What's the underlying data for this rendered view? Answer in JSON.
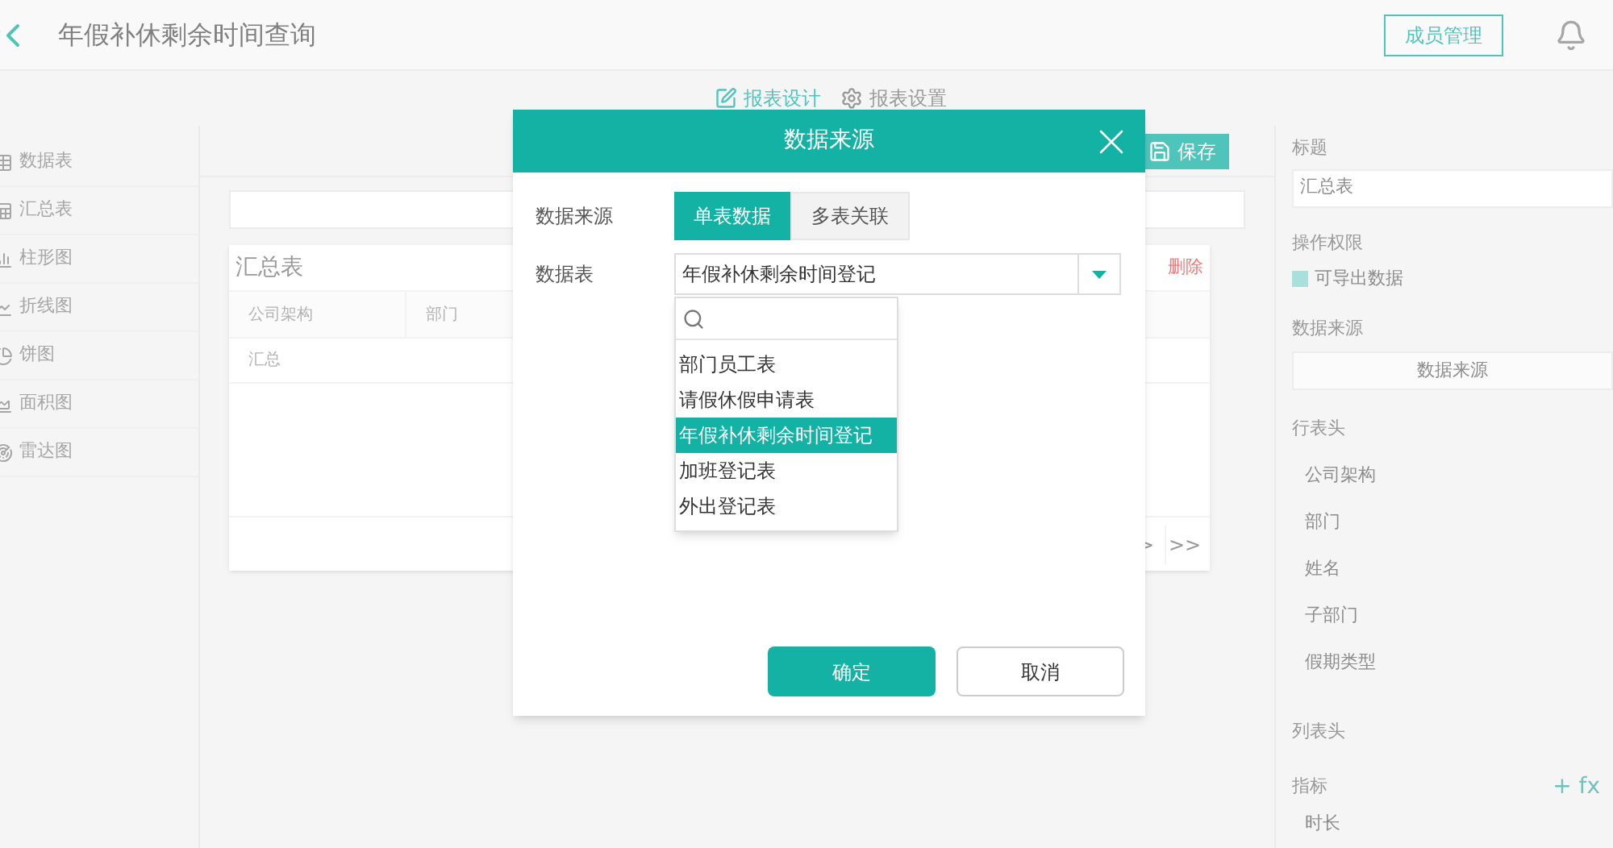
{
  "header": {
    "title": "年假补休剩余时间查询",
    "members_button": "成员管理"
  },
  "toolbar": {
    "tabs": [
      {
        "label": "报表设计",
        "selected": true
      },
      {
        "label": "报表设置",
        "selected": false
      }
    ]
  },
  "sidebar": {
    "items": [
      {
        "label": "数据表"
      },
      {
        "label": "汇总表"
      },
      {
        "label": "柱形图"
      },
      {
        "label": "折线图"
      },
      {
        "label": "饼图"
      },
      {
        "label": "面积图"
      },
      {
        "label": "雷达图"
      }
    ]
  },
  "canvas": {
    "save_button": "保存",
    "card": {
      "title": "汇总表",
      "delete": "删除",
      "columns": [
        "公司架构",
        "部门"
      ],
      "rows": [
        [
          "汇总"
        ]
      ],
      "pager": [
        ">",
        ">>"
      ]
    }
  },
  "properties": {
    "title_label": "标题",
    "title_value": "汇总表",
    "permission_label": "操作权限",
    "export": {
      "label": "可导出数据",
      "checked": true
    },
    "source_label": "数据来源",
    "source_button": "数据来源",
    "row_header_label": "行表头",
    "row_headers": [
      "公司架构",
      "部门",
      "姓名",
      "子部门",
      "假期类型"
    ],
    "column_header_label": "列表头",
    "metric_label": "指标",
    "metric_add": "+ fx",
    "metrics": [
      "时长"
    ]
  },
  "dialog": {
    "title": "数据来源",
    "source_label": "数据来源",
    "source_tabs": [
      {
        "label": "单表数据",
        "selected": true
      },
      {
        "label": "多表关联",
        "selected": false
      }
    ],
    "table_label": "数据表",
    "table_value": "年假补休剩余时间登记",
    "options": [
      {
        "label": "部门员工表",
        "selected": false
      },
      {
        "label": "请假休假申请表",
        "selected": false
      },
      {
        "label": "年假补休剩余时间登记",
        "selected": true
      },
      {
        "label": "加班登记表",
        "selected": false
      },
      {
        "label": "外出登记表",
        "selected": false
      }
    ],
    "ok": "确定",
    "cancel": "取消"
  }
}
